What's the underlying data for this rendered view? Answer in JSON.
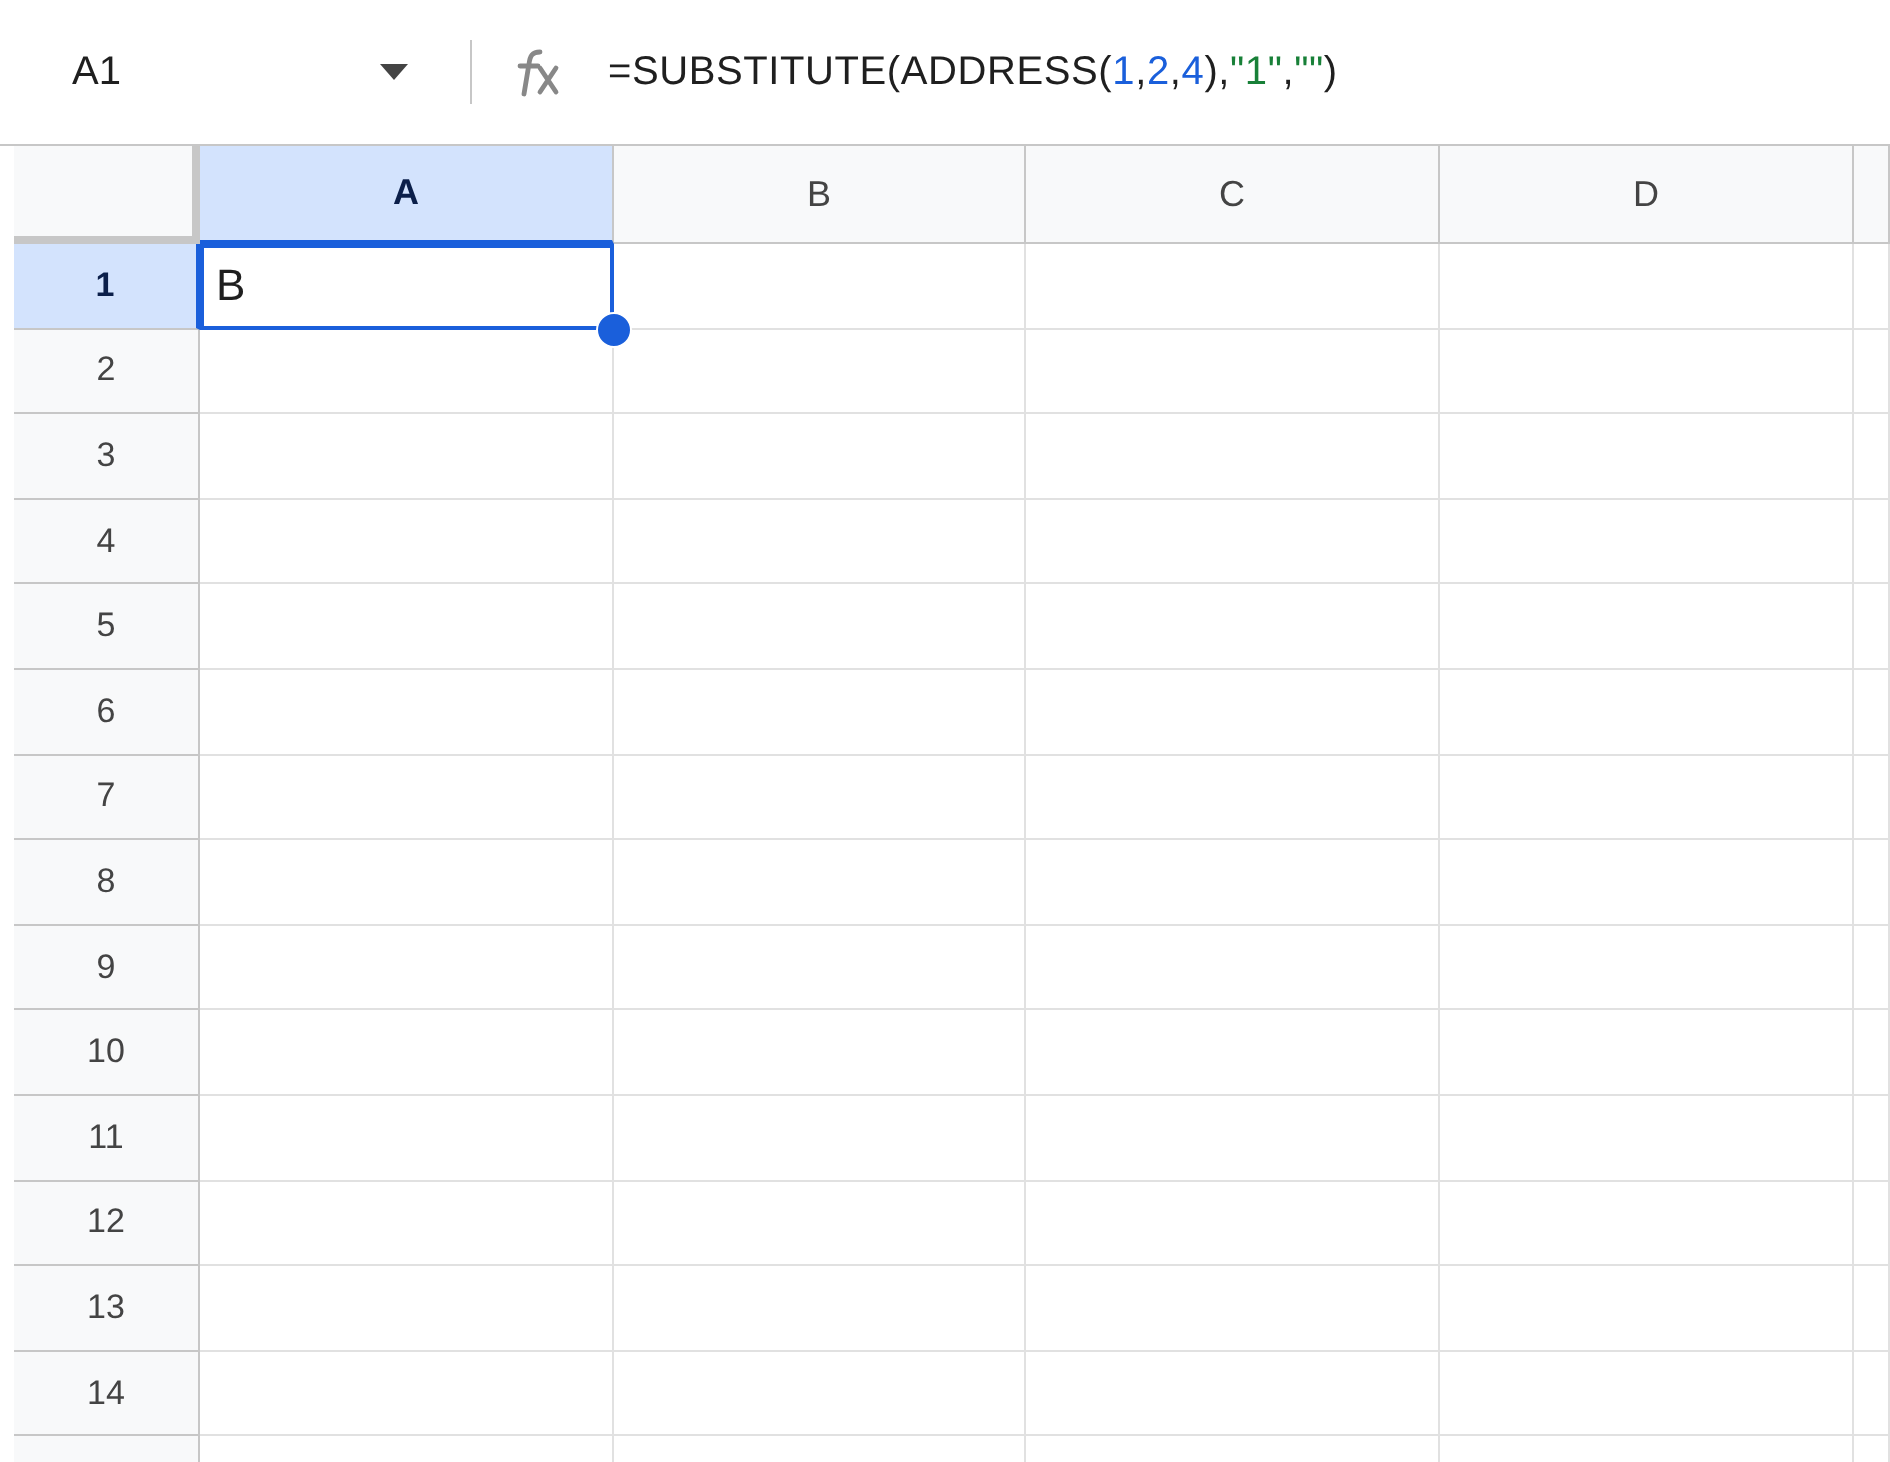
{
  "name_box": {
    "value": "A1"
  },
  "formula_bar": {
    "tokens": [
      {
        "kind": "text",
        "text": "=SUBSTITUTE(ADDRESS("
      },
      {
        "kind": "number",
        "text": "1"
      },
      {
        "kind": "text",
        "text": ","
      },
      {
        "kind": "number",
        "text": "2"
      },
      {
        "kind": "text",
        "text": ","
      },
      {
        "kind": "number",
        "text": "4"
      },
      {
        "kind": "text",
        "text": "),"
      },
      {
        "kind": "string",
        "text": "\"1\""
      },
      {
        "kind": "text",
        "text": ","
      },
      {
        "kind": "string",
        "text": "\"\""
      },
      {
        "kind": "text",
        "text": ")"
      }
    ]
  },
  "columns": [
    {
      "label": "A",
      "selected": true
    },
    {
      "label": "B",
      "selected": false
    },
    {
      "label": "C",
      "selected": false
    },
    {
      "label": "D",
      "selected": false
    }
  ],
  "rows": [
    {
      "label": "1",
      "selected": true,
      "cells": [
        {
          "value": "B",
          "selected": true
        }
      ]
    },
    {
      "label": "2",
      "selected": false
    },
    {
      "label": "3",
      "selected": false
    },
    {
      "label": "4",
      "selected": false
    },
    {
      "label": "5",
      "selected": false
    },
    {
      "label": "6",
      "selected": false
    },
    {
      "label": "7",
      "selected": false
    },
    {
      "label": "8",
      "selected": false
    },
    {
      "label": "9",
      "selected": false
    },
    {
      "label": "10",
      "selected": false
    },
    {
      "label": "11",
      "selected": false
    },
    {
      "label": "12",
      "selected": false
    },
    {
      "label": "13",
      "selected": false
    },
    {
      "label": "14",
      "selected": false
    }
  ]
}
